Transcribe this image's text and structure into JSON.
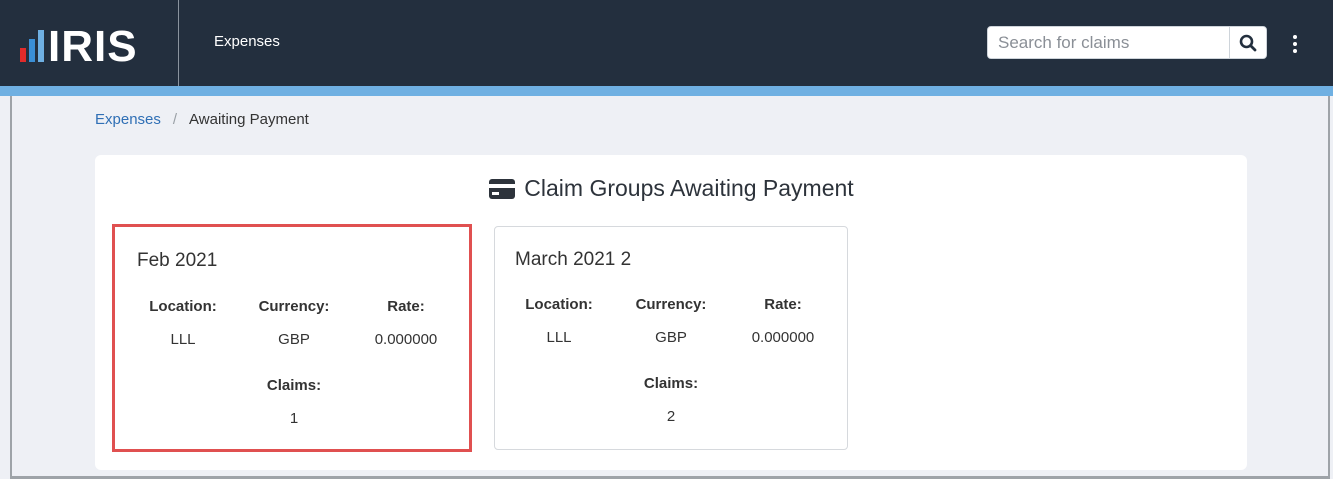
{
  "brand": {
    "logo_text": "IRIS",
    "bar_colors": [
      "#e02b2b",
      "#3a8fd6",
      "#6fb0e2"
    ]
  },
  "navbar": {
    "title": "Expenses"
  },
  "search": {
    "placeholder": "Search for claims"
  },
  "breadcrumb": {
    "items": [
      {
        "label": "Expenses"
      },
      {
        "label": "Awaiting Payment"
      }
    ],
    "separator": "/"
  },
  "page": {
    "title": "Claim Groups Awaiting Payment",
    "title_icon": "credit-card-icon"
  },
  "cards": [
    {
      "title": "Feb 2021",
      "selected": true,
      "location_label": "Location:",
      "location": "LLL",
      "currency_label": "Currency:",
      "currency": "GBP",
      "rate_label": "Rate:",
      "rate": "0.000000",
      "claims_label": "Claims:",
      "claims": "1"
    },
    {
      "title": "March 2021 2",
      "selected": false,
      "location_label": "Location:",
      "location": "LLL",
      "currency_label": "Currency:",
      "currency": "GBP",
      "rate_label": "Rate:",
      "rate": "0.000000",
      "claims_label": "Claims:",
      "claims": "2"
    }
  ],
  "colors": {
    "navbar": "#232f3e",
    "accent": "#6fb0e2",
    "link": "#2f6fb5",
    "selection": "#e05050",
    "background": "#eef0f5"
  }
}
